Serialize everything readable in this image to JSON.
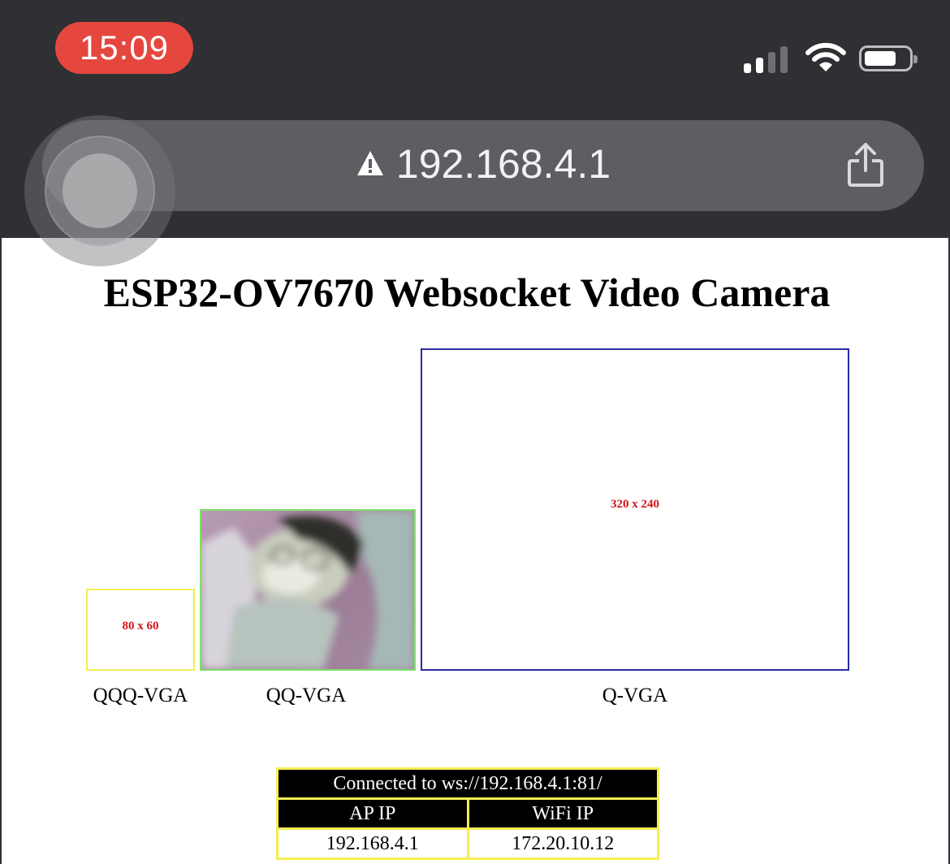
{
  "status_bar": {
    "time": "15:09",
    "icons": [
      "signal-icon",
      "wifi-icon",
      "battery-icon"
    ]
  },
  "browser": {
    "url": "192.168.4.1",
    "icons": [
      "warning-icon",
      "share-icon"
    ]
  },
  "page": {
    "title": "ESP32-OV7670 Websocket Video Camera",
    "cameras": [
      {
        "label": "QQQ-VGA",
        "resolution_text": "80 x 60",
        "border_color": "#f4ee53"
      },
      {
        "label": "QQ-VGA",
        "resolution_text": "",
        "border_color": "#7fe06a"
      },
      {
        "label": "Q-VGA",
        "resolution_text": "320 x 240",
        "border_color": "#2b2ba8"
      }
    ],
    "connection": {
      "status": "Connected to ws://192.168.4.1:81/",
      "ap_ip_header": "AP IP",
      "wifi_ip_header": "WiFi IP",
      "ap_ip": "192.168.4.1",
      "wifi_ip": "172.20.10.12"
    }
  },
  "colors": {
    "chrome": "#2f3033",
    "time_pill": "#e5473f",
    "resolution_text": "#d4141a",
    "table_border": "#f4ee53"
  }
}
